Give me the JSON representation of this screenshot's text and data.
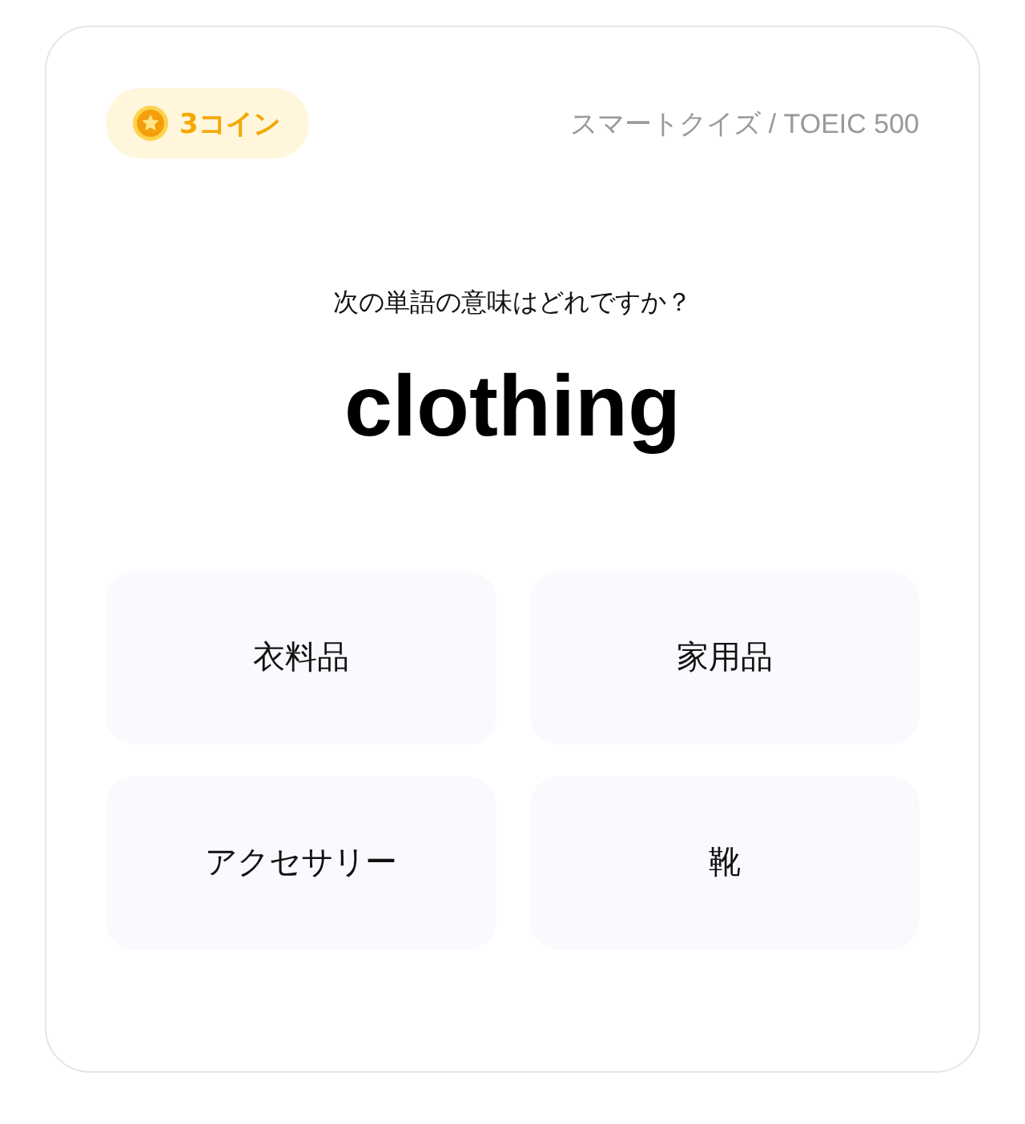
{
  "coins": {
    "label": "3コイン"
  },
  "breadcrumb": "スマートクイズ / TOEIC 500",
  "prompt": "次の単語の意味はどれですか？",
  "word": "clothing",
  "options": [
    {
      "label": "衣料品"
    },
    {
      "label": "家用品"
    },
    {
      "label": "アクセサリー"
    },
    {
      "label": "靴"
    }
  ]
}
